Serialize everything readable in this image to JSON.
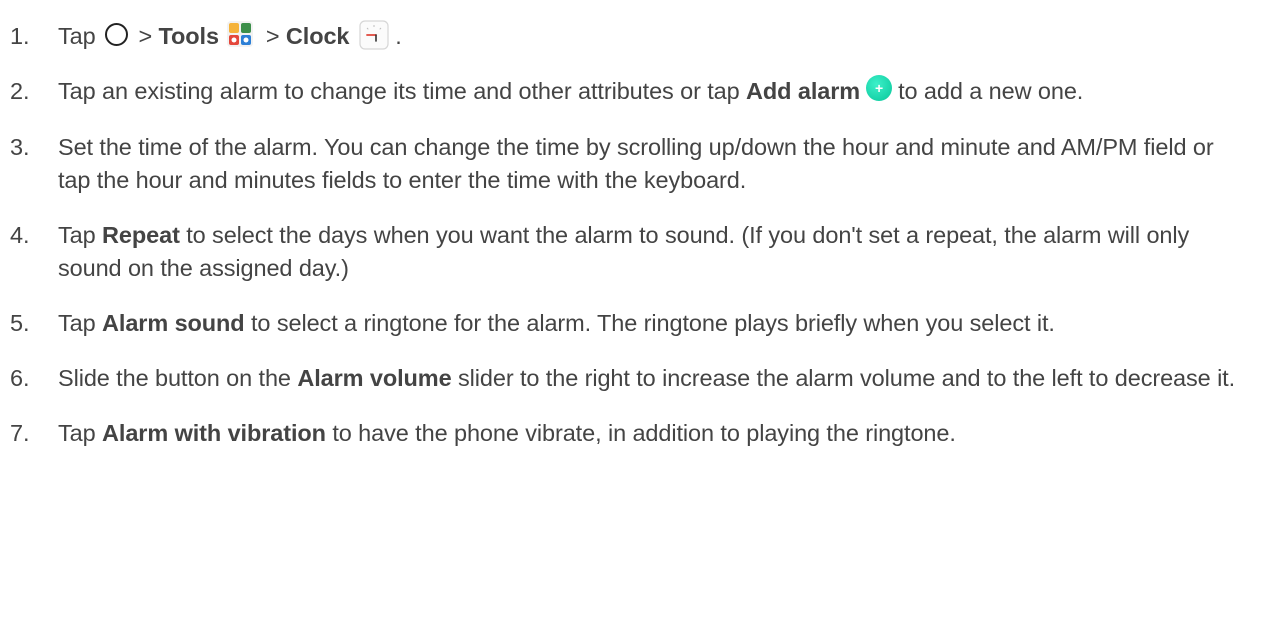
{
  "steps": [
    {
      "number": "1.",
      "t1": "Tap",
      "t2": ">",
      "b1": "Tools",
      "t3": ">",
      "b2": "Clock",
      "t4": "."
    },
    {
      "number": "2.",
      "t1": "Tap an existing alarm to change its time and other attributes or tap",
      "b1": "Add alarm",
      "t2": "to add a new one."
    },
    {
      "number": "3.",
      "t1": "Set the time of the alarm. You can change the time by scrolling up/down the hour and minute and AM/PM field or tap the hour and minutes fields to enter the time with the keyboard."
    },
    {
      "number": "4.",
      "t1": "Tap",
      "b1": "Repeat",
      "t2": "to select the days when you want the alarm to sound. (If you don't set a repeat, the alarm will only sound on the assigned day.)"
    },
    {
      "number": "5.",
      "t1": "Tap",
      "b1": "Alarm sound",
      "t2": "to select a ringtone for the alarm. The ringtone plays briefly when you select it."
    },
    {
      "number": "6.",
      "t1": "Slide the button on the",
      "b1": "Alarm volume",
      "t2": "slider to the right to increase the alarm volume and to the left to decrease it."
    },
    {
      "number": "7.",
      "t1": "Tap",
      "b1": "Alarm with vibration",
      "t2": "to have the phone vibrate, in addition to playing the ringtone."
    }
  ],
  "icons": {
    "home": "home-circle-icon",
    "tools": "tools-folder-icon",
    "clock": "clock-app-icon",
    "add": "add-alarm-plus-icon"
  },
  "colors": {
    "text": "#444444",
    "add_button": "#17d3a8"
  }
}
